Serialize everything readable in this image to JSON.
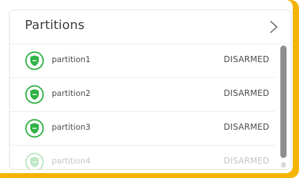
{
  "widget": {
    "title": "Partitions",
    "accent_color": "#f4b400",
    "icon_color": "#2fb344",
    "chevron_icon": "chevron-right-icon"
  },
  "partitions": [
    {
      "name": "partition1",
      "status": "DISARMED",
      "icon": "shield-icon"
    },
    {
      "name": "partition2",
      "status": "DISARMED",
      "icon": "shield-icon"
    },
    {
      "name": "partition3",
      "status": "DISARMED",
      "icon": "shield-icon"
    },
    {
      "name": "partition4",
      "status": "DISARMED",
      "icon": "shield-icon"
    }
  ]
}
